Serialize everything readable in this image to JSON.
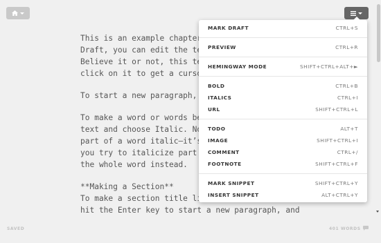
{
  "toolbar": {
    "home_icon": "home-icon",
    "menu_icon": "hamburger-icon"
  },
  "editor": {
    "lines": [
      "This is an example chapter",
      "Draft, you can edit the te",
      "Believe it or not, this te",
      "click on it to get a curso",
      "",
      "To start a new paragraph, h",
      "",
      "To make a word or words be",
      "text and choose Italic. No",
      "part of a word italic–it’s",
      "you try to italicize part o",
      "the whole word instead.",
      "",
      "**Making a Section**",
      "To make a section title li",
      "hit the Enter key to start a new paragraph, and"
    ]
  },
  "status": {
    "saved": "SAVED",
    "words": "401 WORDS",
    "chat_icon": "speech-bubble-icon"
  },
  "menu": {
    "items": [
      {
        "label": "MARK DRAFT",
        "shortcut": "CTRL+S"
      },
      {
        "label": "PREVIEW",
        "shortcut": "CTRL+R"
      },
      {
        "label": "HEMINGWAY MODE",
        "shortcut": "SHIFT+CTRL+ALT+►"
      },
      {
        "label": "BOLD",
        "shortcut": "CTRL+B"
      },
      {
        "label": "ITALICS",
        "shortcut": "CTRL+I"
      },
      {
        "label": "URL",
        "shortcut": "SHIFT+CTRL+L"
      },
      {
        "label": "TODO",
        "shortcut": "ALT+T"
      },
      {
        "label": "IMAGE",
        "shortcut": "SHIFT+CTRL+I"
      },
      {
        "label": "COMMENT",
        "shortcut": "CTRL+/"
      },
      {
        "label": "FOOTNOTE",
        "shortcut": "SHIFT+CTRL+F"
      },
      {
        "label": "MARK SNIPPET",
        "shortcut": "SHIFT+CTRL+Y"
      },
      {
        "label": "INSERT SNIPPET",
        "shortcut": "ALT+CTRL+Y"
      }
    ]
  }
}
